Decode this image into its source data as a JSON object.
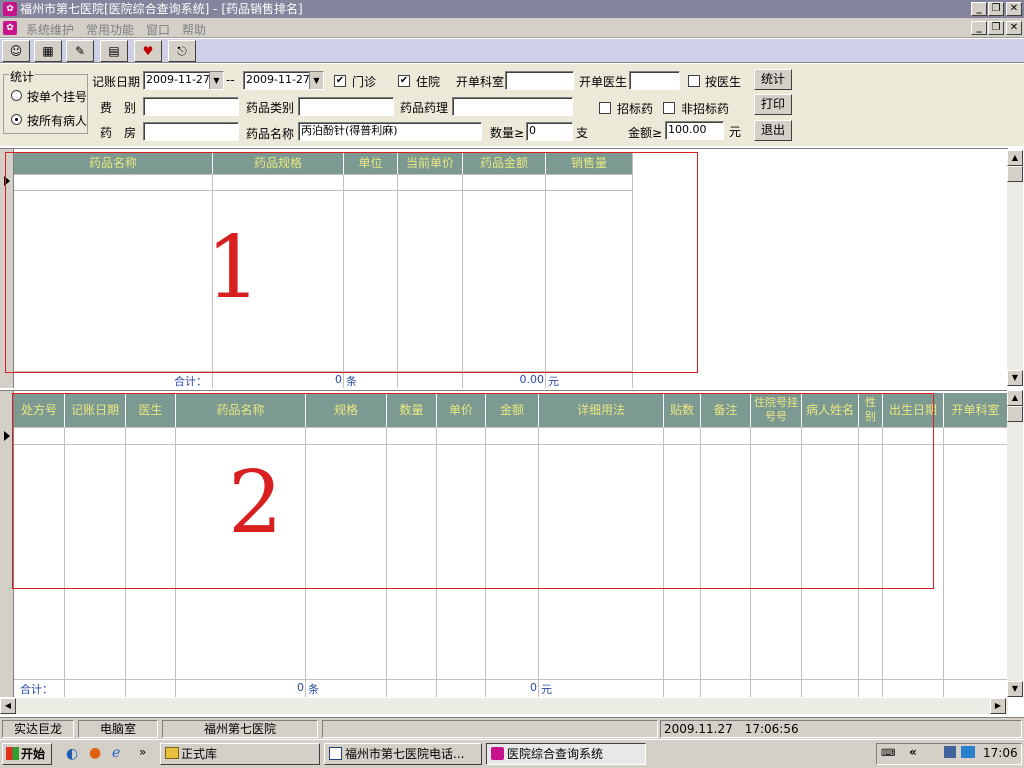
{
  "window": {
    "title": "福州市第七医院[医院综合查询系统] - [药品销售排名]",
    "controls": [
      "_",
      "❐",
      "✕"
    ]
  },
  "menu": {
    "items": [
      "系统维护",
      "常用功能",
      "窗口",
      "帮助"
    ]
  },
  "toolbar": {
    "icons": [
      "user-icon",
      "view-icon",
      "edit-icon",
      "print-icon",
      "heart-icon",
      "exit-door-icon"
    ]
  },
  "filter": {
    "group_title": "统计",
    "radio_single": "按单个挂号",
    "radio_all": "按所有病人",
    "date_label": "记账日期",
    "date_from": "2009-11-27",
    "date_sep": "--",
    "date_to": "2009-11-27",
    "outpatient_label": "门诊",
    "inpatient_label": "住院",
    "dept_label": "开单科室",
    "doctor_label": "开单医生",
    "by_doctor_label": "按医生",
    "fee_label": "费　别",
    "drug_type_label": "药品类别",
    "drug_pharm_label": "药品药理",
    "bid_label": "招标药",
    "nonbid_label": "非招标药",
    "pharmacy_label": "药　房",
    "drug_name_label": "药品名称",
    "drug_name_value": "丙泊酚针(得普利麻)",
    "qty_label": "数量≥",
    "qty_value": "0",
    "qty_unit": "支",
    "amount_label": "金额≥",
    "amount_value": "100.00",
    "amount_unit": "元",
    "btn_stat": "统计",
    "btn_print": "打印",
    "btn_exit": "退出"
  },
  "grid1": {
    "columns": [
      "药品名称",
      "药品规格",
      "单位",
      "当前单价",
      "药品金额",
      "销售量"
    ],
    "total_label": "合计：",
    "total_count": "0",
    "count_unit": "条",
    "total_amount": "0.00",
    "amount_unit": "元",
    "annotation": "1"
  },
  "grid2": {
    "columns": [
      "处方号",
      "记账日期",
      "医生",
      "药品名称",
      "规格",
      "数量",
      "单价",
      "金额",
      "详细用法",
      "贴数",
      "备注",
      "住院号挂号号",
      "病人姓名",
      "性别",
      "出生日期",
      "开单科室"
    ],
    "total_label": "合计：",
    "total_count": "0",
    "count_unit": "条",
    "total_amount": "0",
    "amount_unit": "元",
    "annotation": "2"
  },
  "status": {
    "company": "实达巨龙",
    "room": "电脑室",
    "hospital": "福州第七医院",
    "datetime": "2009.11.27　17:06:56"
  },
  "taskbar": {
    "start": "开始",
    "quick_more": "»",
    "tasks": [
      "正式库",
      "福州市第七医院电话...",
      "医院综合查询系统"
    ],
    "tray_arrow": "«",
    "clock": "17:06"
  }
}
